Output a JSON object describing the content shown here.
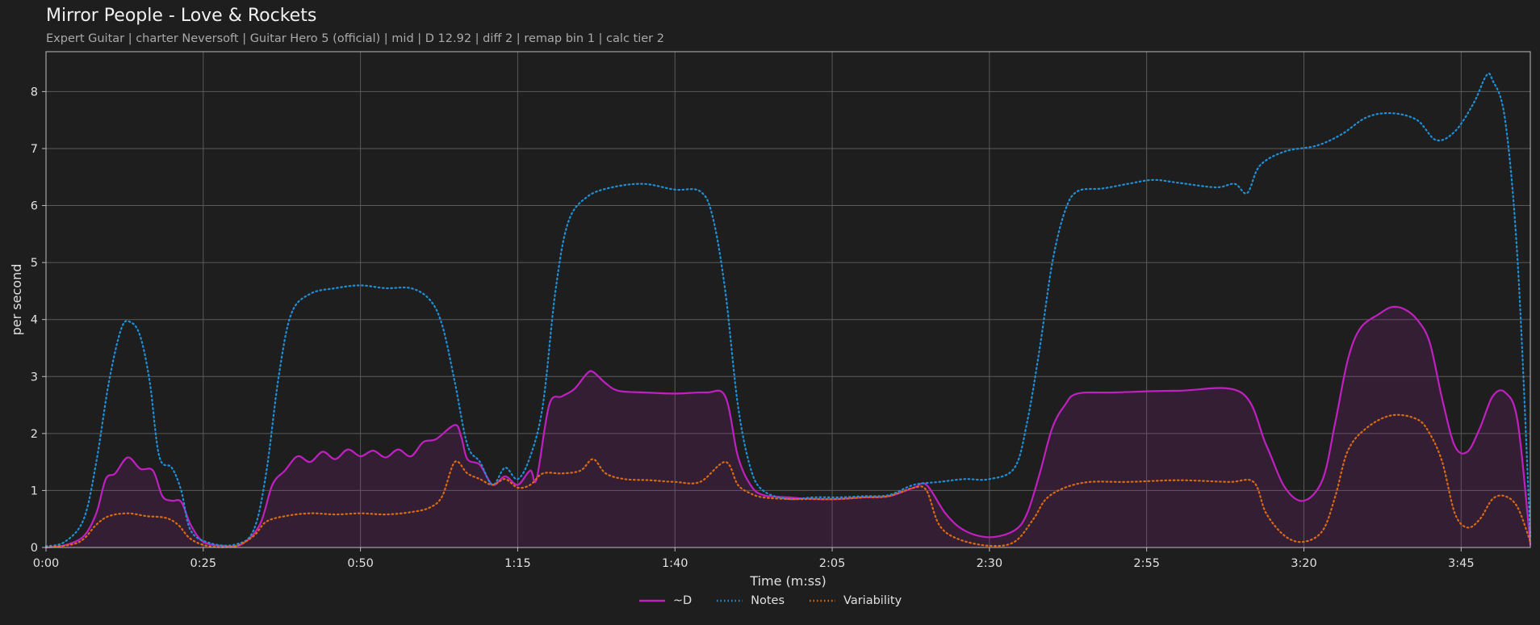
{
  "title": "Mirror People - Love & Rockets",
  "subtitle": "Expert Guitar  |  charter Neversoft  |  Guitar Hero 5 (official)  |  mid  |  D 12.92  |  diff 2  |  remap bin 1  |  calc tier 2",
  "chart_data": {
    "type": "line",
    "xlabel": "Time (m:ss)",
    "ylabel": "per second",
    "xlim": [
      0,
      236
    ],
    "ylim": [
      0,
      8.7
    ],
    "xticks": [
      0,
      25,
      50,
      75,
      100,
      125,
      150,
      175,
      200,
      225
    ],
    "xtick_labels": [
      "0:00",
      "0:25",
      "0:50",
      "1:15",
      "1:40",
      "2:05",
      "2:30",
      "2:55",
      "3:20",
      "3:45"
    ],
    "yticks": [
      0,
      1,
      2,
      3,
      4,
      5,
      6,
      7,
      8
    ],
    "grid": true,
    "legend_position": "bottom-center",
    "series": [
      {
        "name": "~D",
        "color": "#c020c0",
        "style": "solid",
        "fill": true,
        "points": [
          [
            0,
            0
          ],
          [
            3,
            0.04
          ],
          [
            6,
            0.2
          ],
          [
            8,
            0.6
          ],
          [
            9.5,
            1.2
          ],
          [
            11,
            1.3
          ],
          [
            13,
            1.58
          ],
          [
            15,
            1.38
          ],
          [
            17,
            1.35
          ],
          [
            18.5,
            0.9
          ],
          [
            20,
            0.82
          ],
          [
            21.5,
            0.8
          ],
          [
            23,
            0.4
          ],
          [
            25,
            0.1
          ],
          [
            28,
            0.03
          ],
          [
            31,
            0.05
          ],
          [
            34,
            0.4
          ],
          [
            36,
            1.1
          ],
          [
            38,
            1.35
          ],
          [
            40,
            1.6
          ],
          [
            42,
            1.5
          ],
          [
            44,
            1.68
          ],
          [
            46,
            1.55
          ],
          [
            48,
            1.72
          ],
          [
            50,
            1.6
          ],
          [
            52,
            1.7
          ],
          [
            54,
            1.58
          ],
          [
            56,
            1.72
          ],
          [
            58,
            1.6
          ],
          [
            60,
            1.85
          ],
          [
            62,
            1.9
          ],
          [
            65,
            2.15
          ],
          [
            66,
            1.95
          ],
          [
            67,
            1.55
          ],
          [
            69,
            1.45
          ],
          [
            71,
            1.1
          ],
          [
            73,
            1.25
          ],
          [
            75,
            1.1
          ],
          [
            77,
            1.35
          ],
          [
            78,
            1.2
          ],
          [
            80,
            2.5
          ],
          [
            82,
            2.65
          ],
          [
            84,
            2.78
          ],
          [
            86,
            3.05
          ],
          [
            87,
            3.08
          ],
          [
            89,
            2.88
          ],
          [
            91,
            2.75
          ],
          [
            95,
            2.72
          ],
          [
            100,
            2.7
          ],
          [
            105,
            2.72
          ],
          [
            108,
            2.65
          ],
          [
            110,
            1.6
          ],
          [
            112,
            1.1
          ],
          [
            114,
            0.92
          ],
          [
            118,
            0.88
          ],
          [
            122,
            0.85
          ],
          [
            126,
            0.85
          ],
          [
            130,
            0.88
          ],
          [
            134,
            0.9
          ],
          [
            138,
            1.05
          ],
          [
            140,
            1.1
          ],
          [
            143,
            0.6
          ],
          [
            146,
            0.3
          ],
          [
            150,
            0.18
          ],
          [
            154,
            0.3
          ],
          [
            156,
            0.6
          ],
          [
            158,
            1.3
          ],
          [
            160,
            2.1
          ],
          [
            162,
            2.5
          ],
          [
            164,
            2.7
          ],
          [
            170,
            2.72
          ],
          [
            180,
            2.75
          ],
          [
            190,
            2.72
          ],
          [
            194,
            1.8
          ],
          [
            197,
            1.05
          ],
          [
            200,
            0.82
          ],
          [
            203,
            1.2
          ],
          [
            205,
            2.2
          ],
          [
            207,
            3.3
          ],
          [
            209,
            3.85
          ],
          [
            212,
            4.1
          ],
          [
            214,
            4.22
          ],
          [
            216,
            4.18
          ],
          [
            218,
            4.0
          ],
          [
            220,
            3.6
          ],
          [
            222,
            2.6
          ],
          [
            224,
            1.78
          ],
          [
            226,
            1.68
          ],
          [
            228,
            2.1
          ],
          [
            230,
            2.65
          ],
          [
            232,
            2.72
          ],
          [
            234,
            2.2
          ],
          [
            236,
            0.05
          ]
        ]
      },
      {
        "name": "Notes",
        "color": "#1f8fd6",
        "style": "dotted",
        "fill": false,
        "points": [
          [
            0,
            0.02
          ],
          [
            3,
            0.1
          ],
          [
            6,
            0.5
          ],
          [
            8,
            1.5
          ],
          [
            10,
            2.9
          ],
          [
            12,
            3.85
          ],
          [
            13.5,
            3.95
          ],
          [
            15,
            3.7
          ],
          [
            16.5,
            2.9
          ],
          [
            18,
            1.6
          ],
          [
            20,
            1.4
          ],
          [
            21.5,
            1.0
          ],
          [
            23,
            0.3
          ],
          [
            26,
            0.08
          ],
          [
            30,
            0.05
          ],
          [
            33,
            0.3
          ],
          [
            35,
            1.3
          ],
          [
            37,
            3.0
          ],
          [
            39,
            4.1
          ],
          [
            42,
            4.45
          ],
          [
            46,
            4.55
          ],
          [
            50,
            4.6
          ],
          [
            54,
            4.55
          ],
          [
            58,
            4.55
          ],
          [
            61,
            4.35
          ],
          [
            63,
            3.9
          ],
          [
            65,
            2.9
          ],
          [
            67,
            1.8
          ],
          [
            69,
            1.5
          ],
          [
            71,
            1.1
          ],
          [
            73,
            1.4
          ],
          [
            75,
            1.2
          ],
          [
            77,
            1.6
          ],
          [
            79,
            2.5
          ],
          [
            81,
            4.5
          ],
          [
            83,
            5.7
          ],
          [
            86,
            6.15
          ],
          [
            90,
            6.32
          ],
          [
            95,
            6.38
          ],
          [
            100,
            6.28
          ],
          [
            104,
            6.25
          ],
          [
            106,
            5.8
          ],
          [
            108,
            4.5
          ],
          [
            110,
            2.5
          ],
          [
            112,
            1.4
          ],
          [
            114,
            1.0
          ],
          [
            118,
            0.85
          ],
          [
            122,
            0.88
          ],
          [
            126,
            0.88
          ],
          [
            130,
            0.9
          ],
          [
            134,
            0.92
          ],
          [
            138,
            1.1
          ],
          [
            142,
            1.15
          ],
          [
            146,
            1.2
          ],
          [
            150,
            1.2
          ],
          [
            154,
            1.4
          ],
          [
            156,
            2.2
          ],
          [
            158,
            3.5
          ],
          [
            160,
            5.0
          ],
          [
            162,
            5.9
          ],
          [
            164,
            6.25
          ],
          [
            168,
            6.3
          ],
          [
            172,
            6.38
          ],
          [
            176,
            6.45
          ],
          [
            180,
            6.4
          ],
          [
            186,
            6.32
          ],
          [
            189,
            6.38
          ],
          [
            191,
            6.22
          ],
          [
            193,
            6.7
          ],
          [
            197,
            6.95
          ],
          [
            202,
            7.05
          ],
          [
            206,
            7.25
          ],
          [
            210,
            7.55
          ],
          [
            214,
            7.62
          ],
          [
            218,
            7.5
          ],
          [
            221,
            7.15
          ],
          [
            224,
            7.3
          ],
          [
            227,
            7.8
          ],
          [
            229,
            8.28
          ],
          [
            230,
            8.2
          ],
          [
            232,
            7.5
          ],
          [
            234,
            5.0
          ],
          [
            236,
            0.2
          ]
        ]
      },
      {
        "name": "Variability",
        "color": "#d86a14",
        "style": "dotted",
        "fill": false,
        "points": [
          [
            0,
            0
          ],
          [
            4,
            0.05
          ],
          [
            6,
            0.15
          ],
          [
            8,
            0.4
          ],
          [
            10,
            0.55
          ],
          [
            13,
            0.6
          ],
          [
            16,
            0.55
          ],
          [
            19,
            0.52
          ],
          [
            21,
            0.4
          ],
          [
            23,
            0.15
          ],
          [
            26,
            0.02
          ],
          [
            30,
            0.02
          ],
          [
            33,
            0.2
          ],
          [
            35,
            0.45
          ],
          [
            38,
            0.55
          ],
          [
            42,
            0.6
          ],
          [
            46,
            0.58
          ],
          [
            50,
            0.6
          ],
          [
            54,
            0.58
          ],
          [
            58,
            0.62
          ],
          [
            61,
            0.7
          ],
          [
            63,
            0.9
          ],
          [
            65,
            1.5
          ],
          [
            67,
            1.3
          ],
          [
            69,
            1.2
          ],
          [
            71,
            1.1
          ],
          [
            73,
            1.2
          ],
          [
            75,
            1.05
          ],
          [
            77,
            1.1
          ],
          [
            79,
            1.3
          ],
          [
            82,
            1.3
          ],
          [
            85,
            1.35
          ],
          [
            87,
            1.55
          ],
          [
            89,
            1.3
          ],
          [
            92,
            1.2
          ],
          [
            96,
            1.18
          ],
          [
            100,
            1.15
          ],
          [
            104,
            1.15
          ],
          [
            108,
            1.5
          ],
          [
            110,
            1.1
          ],
          [
            112,
            0.95
          ],
          [
            114,
            0.88
          ],
          [
            118,
            0.85
          ],
          [
            122,
            0.85
          ],
          [
            126,
            0.85
          ],
          [
            130,
            0.88
          ],
          [
            134,
            0.9
          ],
          [
            138,
            1.05
          ],
          [
            140,
            1.0
          ],
          [
            142,
            0.4
          ],
          [
            145,
            0.15
          ],
          [
            150,
            0.03
          ],
          [
            154,
            0.1
          ],
          [
            157,
            0.5
          ],
          [
            159,
            0.85
          ],
          [
            162,
            1.05
          ],
          [
            166,
            1.15
          ],
          [
            172,
            1.15
          ],
          [
            180,
            1.18
          ],
          [
            188,
            1.15
          ],
          [
            192,
            1.15
          ],
          [
            194,
            0.6
          ],
          [
            197,
            0.2
          ],
          [
            200,
            0.1
          ],
          [
            203,
            0.3
          ],
          [
            205,
            0.9
          ],
          [
            207,
            1.7
          ],
          [
            210,
            2.1
          ],
          [
            214,
            2.32
          ],
          [
            218,
            2.25
          ],
          [
            220,
            2.0
          ],
          [
            222,
            1.5
          ],
          [
            224,
            0.6
          ],
          [
            226,
            0.35
          ],
          [
            228,
            0.5
          ],
          [
            230,
            0.85
          ],
          [
            232,
            0.9
          ],
          [
            234,
            0.7
          ],
          [
            236,
            0.1
          ]
        ]
      }
    ]
  }
}
